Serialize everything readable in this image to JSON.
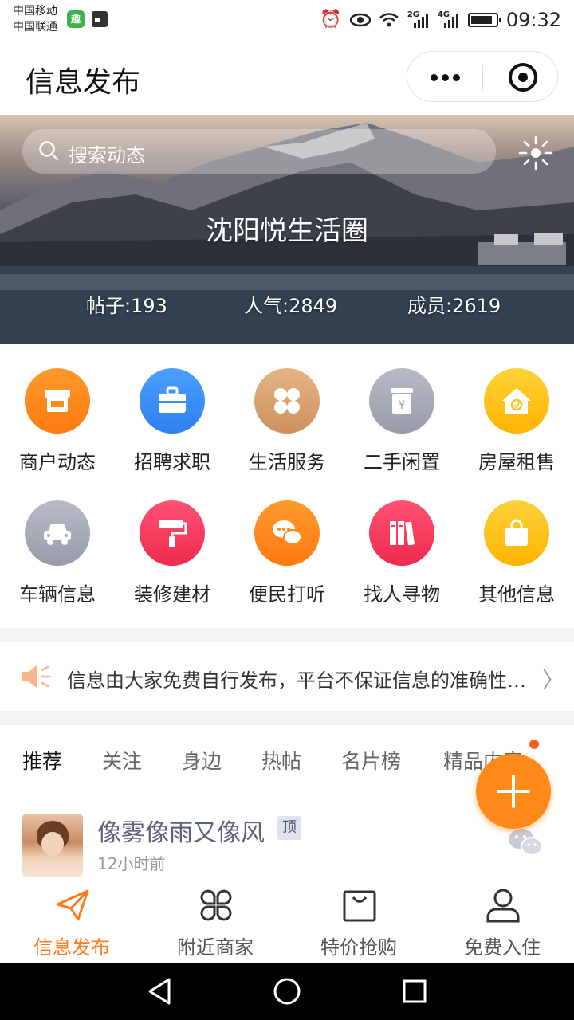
{
  "status_bar": {
    "carrier_1": "中国移动",
    "carrier_2": "中国联通",
    "net_1": "2G",
    "net_2": "4G",
    "time": "09:32",
    "icons": [
      "app-notification-icon",
      "calendar-icon",
      "alarm-icon",
      "eye-icon",
      "wifi-icon",
      "signal-icon",
      "battery-icon"
    ]
  },
  "nav": {
    "title": "信息发布",
    "icons": [
      "more-dots-icon",
      "target-icon"
    ]
  },
  "banner": {
    "search_placeholder": "搜索动态",
    "title": "沈阳悦生活圈",
    "stats": {
      "posts": "帖子:193",
      "popularity": "人气:2849",
      "members": "成员:2619"
    }
  },
  "categories": [
    {
      "label": "商户动态",
      "icon": "store-icon",
      "color": "#ff8a1a"
    },
    {
      "label": "招聘求职",
      "icon": "briefcase-icon",
      "color": "#3a8bf2"
    },
    {
      "label": "生活服务",
      "icon": "clover-icon",
      "color": "#d9a06c"
    },
    {
      "label": "二手闲置",
      "icon": "yen-box-icon",
      "color": "#a8adb8"
    },
    {
      "label": "房屋租售",
      "icon": "house-icon",
      "color": "#ffc21a"
    },
    {
      "label": "车辆信息",
      "icon": "car-icon",
      "color": "#a8adb8"
    },
    {
      "label": "装修建材",
      "icon": "paint-roller-icon",
      "color": "#f5365c"
    },
    {
      "label": "便民打听",
      "icon": "chat-bubbles-icon",
      "color": "#ff8a1a"
    },
    {
      "label": "找人寻物",
      "icon": "books-icon",
      "color": "#f5365c"
    },
    {
      "label": "其他信息",
      "icon": "shopping-bag-icon",
      "color": "#ffc21a"
    }
  ],
  "notice": {
    "text": "信息由大家免费自行发布，平台不保证信息的准确性…",
    "chevron": "〉"
  },
  "feed_tabs": {
    "items": [
      "推荐",
      "关注",
      "身边",
      "热帖",
      "名片榜",
      "精品内容"
    ],
    "active": "推荐"
  },
  "post": {
    "author": "像雾像雨又像风",
    "badge": "顶",
    "time": "12小时前"
  },
  "tab_bar": [
    {
      "label": "信息发布",
      "icon": "paper-plane-icon",
      "active": true
    },
    {
      "label": "附近商家",
      "icon": "clover-outline-icon",
      "active": false
    },
    {
      "label": "特价抢购",
      "icon": "shopping-bag-outline-icon",
      "active": false
    },
    {
      "label": "免费入住",
      "icon": "user-outline-icon",
      "active": false
    }
  ],
  "colors": {
    "accent": "#ff7a1a",
    "fab": "#ff8a1a",
    "post_name": "#58627a"
  }
}
